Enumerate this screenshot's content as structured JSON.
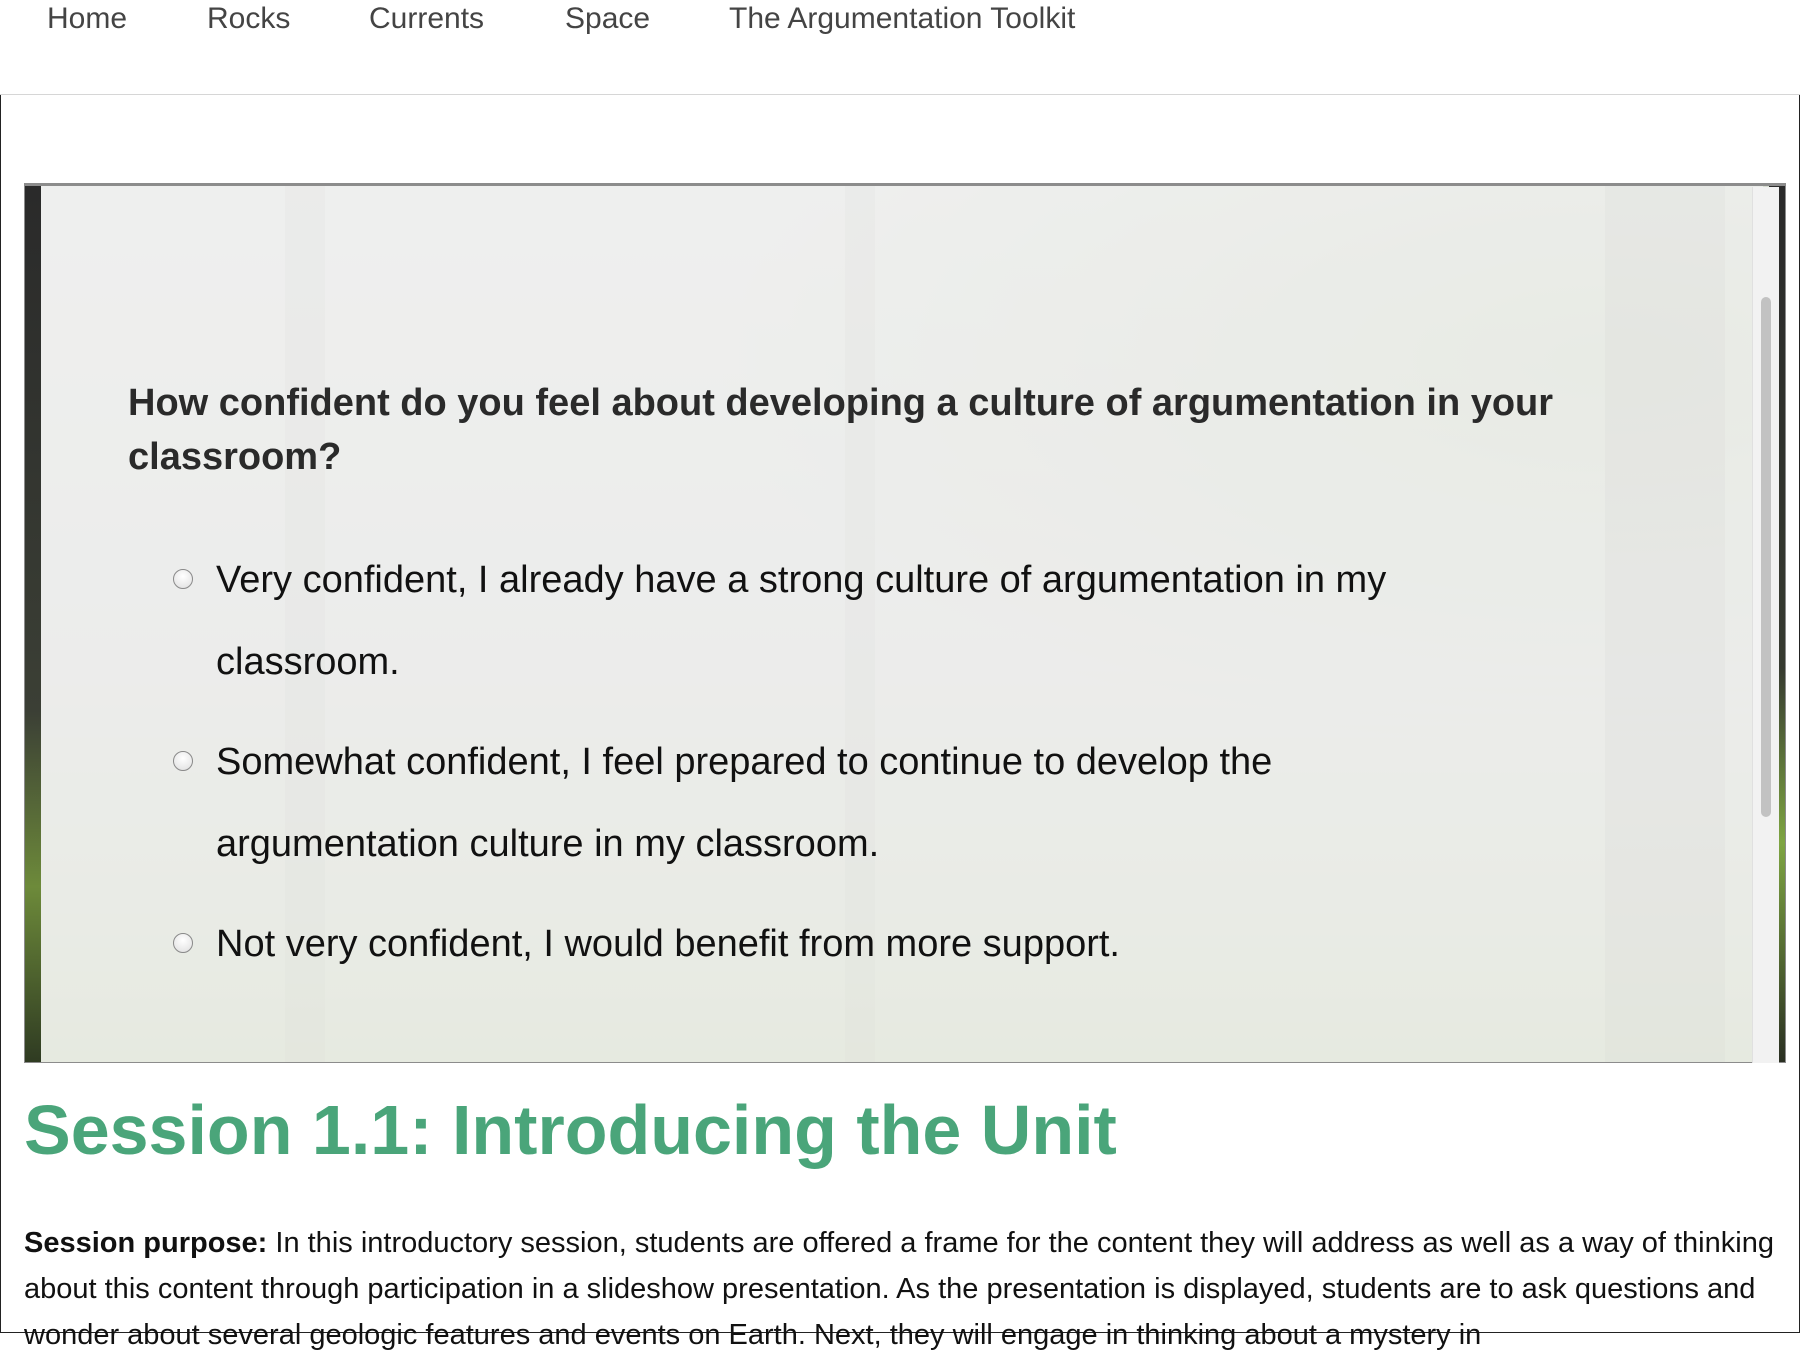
{
  "nav": {
    "items": [
      {
        "label": "Home"
      },
      {
        "label": "Rocks"
      },
      {
        "label": "Currents"
      },
      {
        "label": "Space"
      },
      {
        "label": "The Argumentation Toolkit"
      }
    ]
  },
  "survey": {
    "question": "How confident do you feel about developing a culture of argumentation in your classroom?",
    "options": [
      {
        "label": "Very confident, I already have a strong culture of argumentation in my classroom."
      },
      {
        "label": "Somewhat confident, I feel prepared to continue to develop the argumentation culture in my classroom."
      },
      {
        "label": "Not very confident, I would benefit from more support."
      }
    ]
  },
  "session": {
    "title": "Session 1.1: Introducing the Unit",
    "purpose_label": "Session purpose:",
    "purpose_text": " In this introductory session, students are offered a frame for the content they will address as well as a way of thinking about this content through participation in a slideshow presentation. As the presentation is displayed, students are to ask questions and wonder about several geologic features and events on Earth. Next, they will engage in thinking about a mystery in"
  },
  "colors": {
    "accent": "#4aa57a",
    "nav_text": "#444444"
  }
}
